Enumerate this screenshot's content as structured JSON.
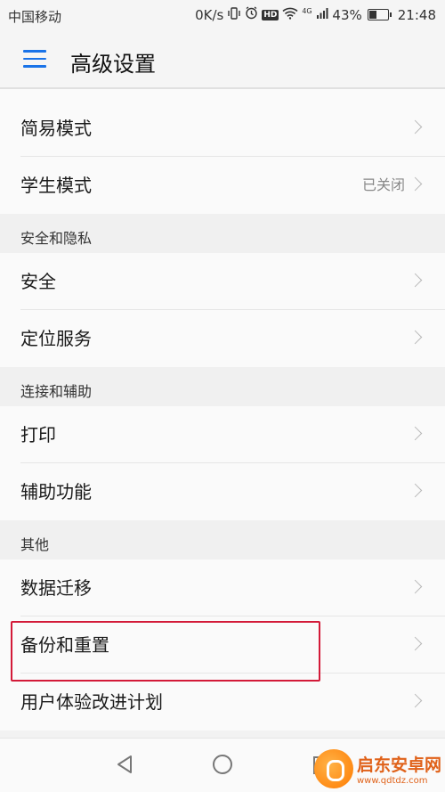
{
  "status_bar": {
    "carrier": "中国移动",
    "speed": "0K/s",
    "network": "4G",
    "battery_percent": "43%",
    "battery_level": 0.43,
    "time": "21:48",
    "icons": [
      "vibrate-icon",
      "alarm-icon",
      "hd-icon",
      "wifi-icon",
      "signal-icon",
      "battery-icon"
    ]
  },
  "header": {
    "title": "高级设置",
    "menu_icon": "hamburger-menu-icon",
    "accent_color": "#1a73e8"
  },
  "list": {
    "items": [
      {
        "type": "row",
        "label": "简易模式",
        "value": ""
      },
      {
        "type": "row",
        "label": "学生模式",
        "value": "已关闭"
      },
      {
        "type": "section",
        "label": "安全和隐私"
      },
      {
        "type": "row",
        "label": "安全",
        "value": ""
      },
      {
        "type": "row",
        "label": "定位服务",
        "value": ""
      },
      {
        "type": "section",
        "label": "连接和辅助"
      },
      {
        "type": "row",
        "label": "打印",
        "value": ""
      },
      {
        "type": "row",
        "label": "辅助功能",
        "value": ""
      },
      {
        "type": "section",
        "label": "其他"
      },
      {
        "type": "row",
        "label": "数据迁移",
        "value": ""
      },
      {
        "type": "row",
        "label": "备份和重置",
        "value": "",
        "highlighted": true
      },
      {
        "type": "row",
        "label": "用户体验改进计划",
        "value": ""
      }
    ]
  },
  "highlight_color": "#d31a38",
  "navbar": {
    "icons": [
      "back-triangle-icon",
      "home-circle-icon",
      "recent-square-icon"
    ]
  },
  "watermark": {
    "title": "启东安卓网",
    "url": "www.qdtdz.com"
  }
}
